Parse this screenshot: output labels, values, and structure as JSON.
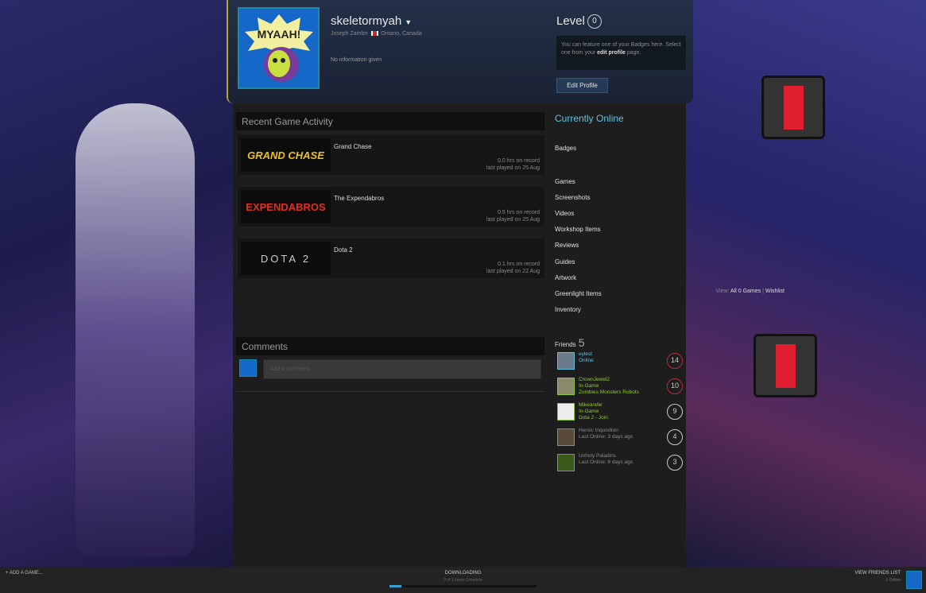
{
  "profile": {
    "username": "skeletormyah",
    "real_name": "Joseph Zambri",
    "location": "Ontario, Canada",
    "info": "No information given",
    "avatar_text": "MYAAH!"
  },
  "level": {
    "label": "Level",
    "value": "0",
    "badge_text_1": "You can feature one of your Badges here. Select one from your ",
    "badge_link": "edit profile",
    "badge_text_2": " page.",
    "edit_button": "Edit Profile"
  },
  "recent": {
    "title": "Recent Game Activity",
    "games": [
      {
        "name": "Grand Chase",
        "logo": "GRAND CHASE",
        "hours": "0.0 hrs on record",
        "last": "last played on 25 Aug"
      },
      {
        "name": "The Expendabros",
        "logo": "EXPENDABROS",
        "hours": "0.5 hrs on record",
        "last": "last played on 25 Aug"
      },
      {
        "name": "Dota 2",
        "logo": "DOTA 2",
        "hours": "0.1 hrs on record",
        "last": "last played on 22 Aug"
      }
    ],
    "view_label": "View:",
    "all_games": "All 0 Games",
    "wishlist": "Wishlist"
  },
  "comments": {
    "title": "Comments",
    "placeholder": "Add a comment"
  },
  "sidebar": {
    "status": "Currently Online",
    "badges": "Badges",
    "items": [
      "Games",
      "Screenshots",
      "Videos",
      "Workshop Items",
      "Reviews",
      "Guides",
      "Artwork",
      "Greenlight Items",
      "Inventory"
    ]
  },
  "friends": {
    "label": "Friends",
    "count": "5",
    "list": [
      {
        "name": "eylest",
        "line2": "Online",
        "line3": "",
        "level": "14",
        "color": "#5bc3e0",
        "ring": "#c0283a"
      },
      {
        "name": "CrownJewel2",
        "line2": "In-Game",
        "line3": "Zombies Monsters Robots",
        "level": "10",
        "color": "#8fc63c",
        "ring": "#c0283a"
      },
      {
        "name": "Mikeandie",
        "line2": "In-Game",
        "line3": "Dota 2 - Join",
        "level": "9",
        "color": "#8fc63c",
        "ring": "#cccccc"
      },
      {
        "name": "Heroic Inquisition",
        "line2": "Last Online: 3 days ago",
        "line3": "",
        "level": "4",
        "color": "#8a8a8a",
        "ring": "#cccccc"
      },
      {
        "name": "Unholy Paladins",
        "line2": "Last Online: 6 days ago",
        "line3": "",
        "level": "3",
        "color": "#8a8a8a",
        "ring": "#cccccc"
      }
    ]
  },
  "bottom": {
    "add_game": "+ ADD A GAME...",
    "downloading": "DOWNLOADING",
    "download_sub": "0 of 1 Items Complete",
    "progress": 0.08,
    "friends_list": "VIEW FRIENDS LIST",
    "friends_online": "1 Online"
  }
}
